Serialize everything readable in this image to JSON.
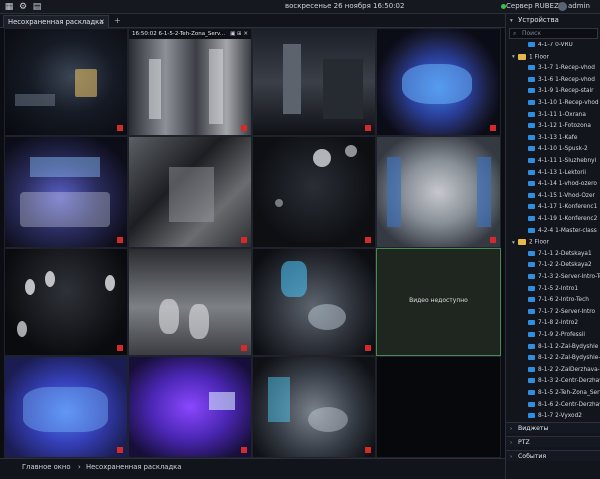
{
  "topbar": {
    "menu_icon": "grid-icon",
    "datetime": "воскресенье 26 ноября 16:50:02",
    "server": "Сервер RUBEZH",
    "user": "admin",
    "status_color": "#39c04a"
  },
  "tabs": {
    "active_tab": "Несохраненная раскладка",
    "close_glyph": "✕",
    "add_glyph": "+"
  },
  "grid": {
    "cells": [
      {
        "label": "",
        "controls": ""
      },
      {
        "label": "16:50:02 6-1-5-2-Teh-Zona_Serv...",
        "controls": "▣ ⊞ ✕"
      },
      {
        "label": "",
        "controls": ""
      },
      {
        "label": "",
        "controls": ""
      },
      {
        "label": "",
        "controls": ""
      },
      {
        "label": "",
        "controls": ""
      },
      {
        "label": "",
        "controls": ""
      },
      {
        "label": "",
        "controls": ""
      },
      {
        "label": "",
        "controls": ""
      },
      {
        "label": "",
        "controls": ""
      },
      {
        "label": "",
        "controls": ""
      },
      {
        "label": "",
        "controls": "",
        "no_video": "Видео недоступно"
      },
      {
        "label": "",
        "controls": ""
      },
      {
        "label": "",
        "controls": ""
      },
      {
        "label": "",
        "controls": ""
      },
      {
        "label": "",
        "controls": ""
      }
    ]
  },
  "sidebar": {
    "header": "Устройства",
    "search_placeholder": "Поиск",
    "items": [
      {
        "type": "cam",
        "label": "4-1-7 0-VRU",
        "indent": 2
      },
      {
        "type": "folder",
        "label": "1 Floor",
        "indent": 1
      },
      {
        "type": "cam",
        "label": "3-1-7 1-Recep-vhod",
        "indent": 2
      },
      {
        "type": "cam",
        "label": "3-1-6 1-Recep-vhod",
        "indent": 2
      },
      {
        "type": "cam",
        "label": "3-1-9 1-Recep-stair",
        "indent": 2
      },
      {
        "type": "cam",
        "label": "3-1-10 1-Recep-vhod",
        "indent": 2
      },
      {
        "type": "cam",
        "label": "3-1-11 1-Oxrana",
        "indent": 2
      },
      {
        "type": "cam",
        "label": "3-1-12 1-Fotozona",
        "indent": 2
      },
      {
        "type": "cam",
        "label": "3-1-13 1-Kafe",
        "indent": 2
      },
      {
        "type": "cam",
        "label": "4-1-10 1-Spusk-2",
        "indent": 2
      },
      {
        "type": "cam",
        "label": "4-1-11 1-Sluzhebnyi",
        "indent": 2
      },
      {
        "type": "cam",
        "label": "4-1-13 1-Lektorii",
        "indent": 2
      },
      {
        "type": "cam",
        "label": "4-1-14 1-vhod-ozero",
        "indent": 2
      },
      {
        "type": "cam",
        "label": "4-1-15 1-Vhod-Ozer",
        "indent": 2
      },
      {
        "type": "cam",
        "label": "4-1-17 1-Konferenc1",
        "indent": 2
      },
      {
        "type": "cam",
        "label": "4-1-19 1-Konferenc2",
        "indent": 2
      },
      {
        "type": "cam",
        "label": "4-2-4 1-Master-class",
        "indent": 2
      },
      {
        "type": "folder",
        "label": "2 Floor",
        "indent": 1
      },
      {
        "type": "cam",
        "label": "7-1-1 2-Detskaya1",
        "indent": 2
      },
      {
        "type": "cam",
        "label": "7-1-2 2-Detskaya2",
        "indent": 2
      },
      {
        "type": "cam",
        "label": "7-1-3 2-Server-Intro-Tech",
        "indent": 2
      },
      {
        "type": "cam",
        "label": "7-1-5 2-Intro1",
        "indent": 2
      },
      {
        "type": "cam",
        "label": "7-1-6 2-Intro-Tech",
        "indent": 2
      },
      {
        "type": "cam",
        "label": "7-1-7 2-Server-Intro",
        "indent": 2
      },
      {
        "type": "cam",
        "label": "7-1-8 2-Intro2",
        "indent": 2
      },
      {
        "type": "cam",
        "label": "7-1-9 2-Professii",
        "indent": 2
      },
      {
        "type": "cam",
        "label": "8-1-1 2-Zal-Bydyshie",
        "indent": 2
      },
      {
        "type": "cam",
        "label": "8-1-2 2-Zal-Bydyshie-trib",
        "indent": 2
      },
      {
        "type": "cam",
        "label": "8-1-2 2-ZalDerzhava-trib",
        "indent": 2
      },
      {
        "type": "cam",
        "label": "8-1-3 2-Centr-Derzhava",
        "indent": 2
      },
      {
        "type": "cam",
        "label": "8-1-5 2-Teh-Zona_Server",
        "indent": 2
      },
      {
        "type": "cam",
        "label": "8-1-6 2-Centr-Derzhava2",
        "indent": 2
      },
      {
        "type": "cam",
        "label": "8-1-7 2-Vyxod2",
        "indent": 2
      }
    ],
    "sections": [
      "Виджеты",
      "PTZ",
      "События"
    ]
  },
  "bottombar": {
    "crumb_main": "Главное окно",
    "crumb_sep": "›",
    "crumb_layout": "Несохраненная раскладка"
  }
}
